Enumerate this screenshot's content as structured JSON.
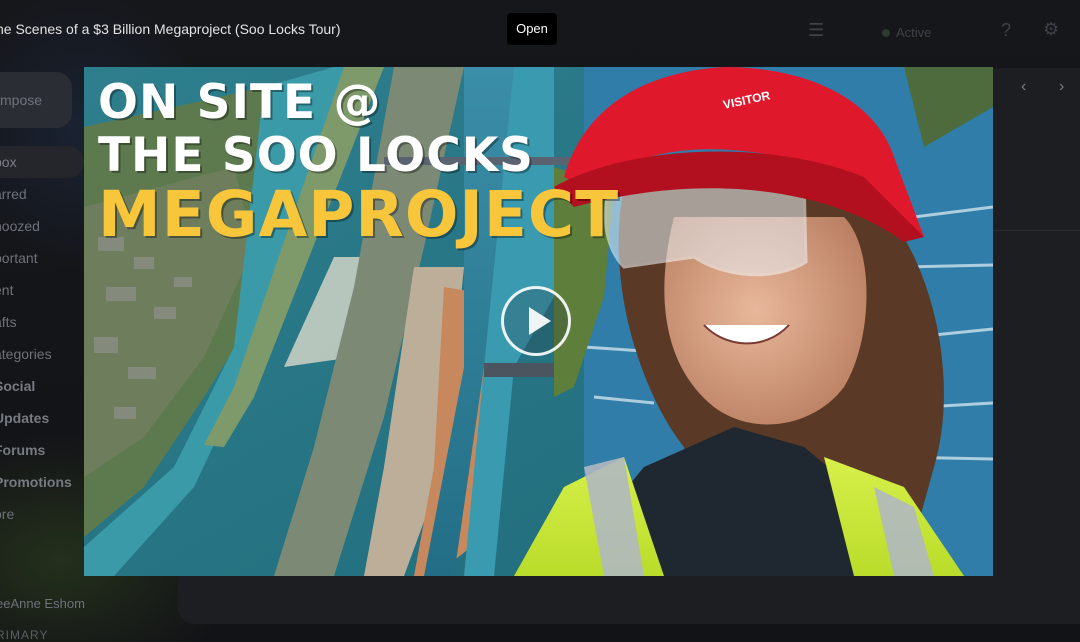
{
  "viewer": {
    "title": "he Scenes of a $3 Billion Megaproject (Soo Locks Tour)",
    "open_label": "Open"
  },
  "video": {
    "headline_line1": "ON SITE @",
    "headline_line2": "THE SOO LOCKS",
    "headline_line3": "MEGAPROJECT",
    "hardhat_text": "VISITOR",
    "accent_color": "#f8c63a"
  },
  "background": {
    "compose_label": "mpose",
    "sidebar_items": [
      "box",
      "arred",
      "noozed",
      "portant",
      "ent",
      "afts",
      "ategories",
      "Social",
      "Updates",
      "Forums",
      "Promotions",
      "ore"
    ],
    "user_name": "eeAnne Eshom",
    "section_label": "RIMARY",
    "status_label": "Active"
  }
}
